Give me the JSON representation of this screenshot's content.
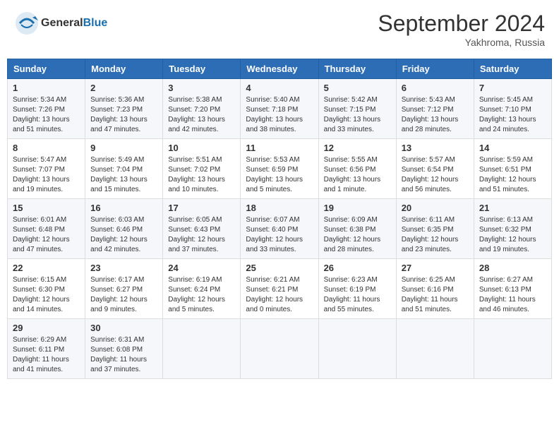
{
  "header": {
    "logo_general": "General",
    "logo_blue": "Blue",
    "month_title": "September 2024",
    "location": "Yakhroma, Russia"
  },
  "weekdays": [
    "Sunday",
    "Monday",
    "Tuesday",
    "Wednesday",
    "Thursday",
    "Friday",
    "Saturday"
  ],
  "weeks": [
    [
      {
        "day": "1",
        "sunrise": "5:34 AM",
        "sunset": "7:26 PM",
        "daylight": "13 hours and 51 minutes."
      },
      {
        "day": "2",
        "sunrise": "5:36 AM",
        "sunset": "7:23 PM",
        "daylight": "13 hours and 47 minutes."
      },
      {
        "day": "3",
        "sunrise": "5:38 AM",
        "sunset": "7:20 PM",
        "daylight": "13 hours and 42 minutes."
      },
      {
        "day": "4",
        "sunrise": "5:40 AM",
        "sunset": "7:18 PM",
        "daylight": "13 hours and 38 minutes."
      },
      {
        "day": "5",
        "sunrise": "5:42 AM",
        "sunset": "7:15 PM",
        "daylight": "13 hours and 33 minutes."
      },
      {
        "day": "6",
        "sunrise": "5:43 AM",
        "sunset": "7:12 PM",
        "daylight": "13 hours and 28 minutes."
      },
      {
        "day": "7",
        "sunrise": "5:45 AM",
        "sunset": "7:10 PM",
        "daylight": "13 hours and 24 minutes."
      }
    ],
    [
      {
        "day": "8",
        "sunrise": "5:47 AM",
        "sunset": "7:07 PM",
        "daylight": "13 hours and 19 minutes."
      },
      {
        "day": "9",
        "sunrise": "5:49 AM",
        "sunset": "7:04 PM",
        "daylight": "13 hours and 15 minutes."
      },
      {
        "day": "10",
        "sunrise": "5:51 AM",
        "sunset": "7:02 PM",
        "daylight": "13 hours and 10 minutes."
      },
      {
        "day": "11",
        "sunrise": "5:53 AM",
        "sunset": "6:59 PM",
        "daylight": "13 hours and 5 minutes."
      },
      {
        "day": "12",
        "sunrise": "5:55 AM",
        "sunset": "6:56 PM",
        "daylight": "13 hours and 1 minute."
      },
      {
        "day": "13",
        "sunrise": "5:57 AM",
        "sunset": "6:54 PM",
        "daylight": "12 hours and 56 minutes."
      },
      {
        "day": "14",
        "sunrise": "5:59 AM",
        "sunset": "6:51 PM",
        "daylight": "12 hours and 51 minutes."
      }
    ],
    [
      {
        "day": "15",
        "sunrise": "6:01 AM",
        "sunset": "6:48 PM",
        "daylight": "12 hours and 47 minutes."
      },
      {
        "day": "16",
        "sunrise": "6:03 AM",
        "sunset": "6:46 PM",
        "daylight": "12 hours and 42 minutes."
      },
      {
        "day": "17",
        "sunrise": "6:05 AM",
        "sunset": "6:43 PM",
        "daylight": "12 hours and 37 minutes."
      },
      {
        "day": "18",
        "sunrise": "6:07 AM",
        "sunset": "6:40 PM",
        "daylight": "12 hours and 33 minutes."
      },
      {
        "day": "19",
        "sunrise": "6:09 AM",
        "sunset": "6:38 PM",
        "daylight": "12 hours and 28 minutes."
      },
      {
        "day": "20",
        "sunrise": "6:11 AM",
        "sunset": "6:35 PM",
        "daylight": "12 hours and 23 minutes."
      },
      {
        "day": "21",
        "sunrise": "6:13 AM",
        "sunset": "6:32 PM",
        "daylight": "12 hours and 19 minutes."
      }
    ],
    [
      {
        "day": "22",
        "sunrise": "6:15 AM",
        "sunset": "6:30 PM",
        "daylight": "12 hours and 14 minutes."
      },
      {
        "day": "23",
        "sunrise": "6:17 AM",
        "sunset": "6:27 PM",
        "daylight": "12 hours and 9 minutes."
      },
      {
        "day": "24",
        "sunrise": "6:19 AM",
        "sunset": "6:24 PM",
        "daylight": "12 hours and 5 minutes."
      },
      {
        "day": "25",
        "sunrise": "6:21 AM",
        "sunset": "6:21 PM",
        "daylight": "12 hours and 0 minutes."
      },
      {
        "day": "26",
        "sunrise": "6:23 AM",
        "sunset": "6:19 PM",
        "daylight": "11 hours and 55 minutes."
      },
      {
        "day": "27",
        "sunrise": "6:25 AM",
        "sunset": "6:16 PM",
        "daylight": "11 hours and 51 minutes."
      },
      {
        "day": "28",
        "sunrise": "6:27 AM",
        "sunset": "6:13 PM",
        "daylight": "11 hours and 46 minutes."
      }
    ],
    [
      {
        "day": "29",
        "sunrise": "6:29 AM",
        "sunset": "6:11 PM",
        "daylight": "11 hours and 41 minutes."
      },
      {
        "day": "30",
        "sunrise": "6:31 AM",
        "sunset": "6:08 PM",
        "daylight": "11 hours and 37 minutes."
      },
      null,
      null,
      null,
      null,
      null
    ]
  ],
  "labels": {
    "sunrise": "Sunrise:",
    "sunset": "Sunset:",
    "daylight": "Daylight:"
  }
}
